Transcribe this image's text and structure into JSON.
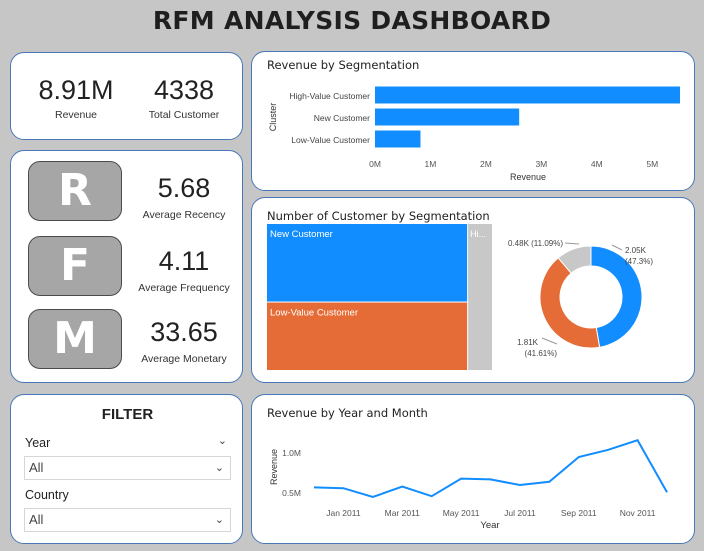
{
  "title": "RFM ANALYSIS DASHBOARD",
  "kpis": {
    "revenue": {
      "value": "8.91M",
      "label": "Revenue"
    },
    "customers": {
      "value": "4338",
      "label": "Total Customer"
    }
  },
  "rfm": {
    "r": {
      "letter": "R",
      "value": "5.68",
      "label": "Average Recency"
    },
    "f": {
      "letter": "F",
      "value": "4.11",
      "label": "Average Frequency"
    },
    "m": {
      "letter": "M",
      "value": "33.65",
      "label": "Average Monetary"
    }
  },
  "filter": {
    "title": "FILTER",
    "year": {
      "label": "Year",
      "value": "All"
    },
    "country": {
      "label": "Country",
      "value": "All"
    }
  },
  "colors": {
    "blue": "#118DFF",
    "orange": "#E66C37",
    "grey": "#C8C8C8"
  },
  "icons": {
    "collapse": "chevron-down-icon",
    "dropdown": "chevron-down-icon"
  },
  "chart_data": [
    {
      "type": "bar",
      "orientation": "horizontal",
      "title": "Revenue by Segmentation",
      "xlabel": "Revenue",
      "ylabel": "Cluster",
      "categories": [
        "High-Value Customer",
        "New Customer",
        "Low-Value Customer"
      ],
      "values": [
        5.5,
        2.6,
        0.82
      ],
      "value_unit": "M",
      "xlim": [
        0,
        5.5
      ],
      "xticks": [
        "0M",
        "1M",
        "2M",
        "3M",
        "4M",
        "5M"
      ],
      "grid": false
    },
    {
      "type": "treemap",
      "title": "Number of Customer by Segmentation",
      "categories": [
        "New Customer",
        "Low-Value Customer",
        "Hi..."
      ],
      "values": [
        2050,
        1810,
        480
      ]
    },
    {
      "type": "pie",
      "donut": true,
      "slices": [
        {
          "label": "2.05K",
          "pct": "(47.3%)",
          "value": 47.3
        },
        {
          "label": "1.81K",
          "pct": "(41.61%)",
          "value": 41.61
        },
        {
          "label": "0.48K (11.09%)",
          "pct": "",
          "value": 11.09
        }
      ]
    },
    {
      "type": "line",
      "title": "Revenue by Year and Month",
      "xlabel": "Year",
      "ylabel": "Revenue",
      "x": [
        "Dec 2010",
        "Jan 2011",
        "Feb 2011",
        "Mar 2011",
        "Apr 2011",
        "May 2011",
        "Jun 2011",
        "Jul 2011",
        "Aug 2011",
        "Sep 2011",
        "Oct 2011",
        "Nov 2011",
        "Dec 2011"
      ],
      "values": [
        0.57,
        0.56,
        0.45,
        0.58,
        0.46,
        0.68,
        0.67,
        0.6,
        0.64,
        0.95,
        1.04,
        1.16,
        0.51
      ],
      "value_unit": "M",
      "xticks": [
        "Jan 2011",
        "Mar 2011",
        "May 2011",
        "Jul 2011",
        "Sep 2011",
        "Nov 2011"
      ],
      "yticks": [
        "0.5M",
        "1.0M"
      ],
      "ylim": [
        0.35,
        1.25
      ],
      "grid": false
    }
  ]
}
